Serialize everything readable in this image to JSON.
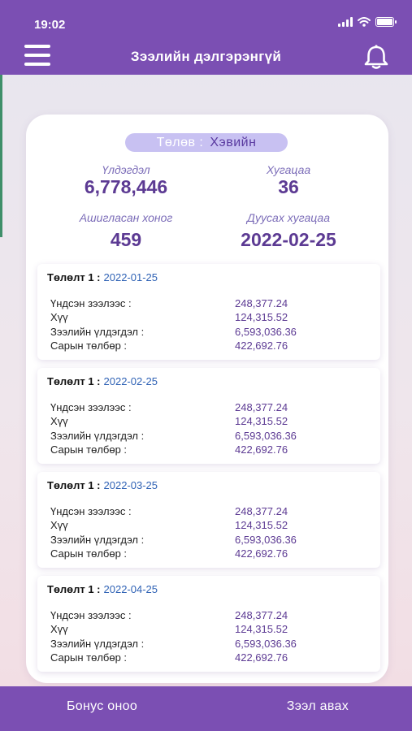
{
  "status_bar": {
    "time": "19:02"
  },
  "header": {
    "title": "Зээлийн дэлгэрэнгүй",
    "menu_icon": "hamburger-icon",
    "bell_icon": "bell-icon"
  },
  "loan": {
    "status_label": "Төлөв :",
    "status_value": "Хэвийн",
    "balance_label": "Үлдэгдэл",
    "balance_value": "6,778,446",
    "term_label": "Хугацаа",
    "term_value": "36",
    "used_days_label": "Ашигласан хоног",
    "used_days_value": "459",
    "end_date_label": "Дуусах хугацаа",
    "end_date_value": "2022-02-25"
  },
  "payments": [
    {
      "title": "Төлөлт 1 :",
      "date": "2022-01-25",
      "rows": [
        {
          "label": "Үндсэн зээлээс :",
          "value": "248,377.24"
        },
        {
          "label": "Хүү",
          "value": "124,315.52"
        },
        {
          "label": "Зээлийн үлдэгдэл :",
          "value": "6,593,036.36"
        },
        {
          "label": "Сарын төлбөр :",
          "value": "422,692.76"
        }
      ]
    },
    {
      "title": "Төлөлт 1 :",
      "date": "2022-02-25",
      "rows": [
        {
          "label": "Үндсэн зээлээс :",
          "value": "248,377.24"
        },
        {
          "label": "Хүү",
          "value": "124,315.52"
        },
        {
          "label": "Зээлийн үлдэгдэл :",
          "value": "6,593,036.36"
        },
        {
          "label": "Сарын төлбөр :",
          "value": "422,692.76"
        }
      ]
    },
    {
      "title": "Төлөлт 1 :",
      "date": "2022-03-25",
      "rows": [
        {
          "label": "Үндсэн зээлээс :",
          "value": "248,377.24"
        },
        {
          "label": "Хүү",
          "value": "124,315.52"
        },
        {
          "label": "Зээлийн үлдэгдэл :",
          "value": "6,593,036.36"
        },
        {
          "label": "Сарын төлбөр :",
          "value": "422,692.76"
        }
      ]
    },
    {
      "title": "Төлөлт 1 :",
      "date": "2022-04-25",
      "rows": [
        {
          "label": "Үндсэн зээлээс :",
          "value": "248,377.24"
        },
        {
          "label": "Хүү",
          "value": "124,315.52"
        },
        {
          "label": "Зээлийн үлдэгдэл :",
          "value": "6,593,036.36"
        },
        {
          "label": "Сарын төлбөр :",
          "value": "422,692.76"
        }
      ]
    }
  ],
  "footer": {
    "bonus_label": "Бонус оноо",
    "loan_label": "Зээл авах"
  },
  "colors": {
    "primary": "#7b4fb3",
    "accent_text": "#5c3a93",
    "date_blue": "#2f62b5",
    "pill": "#c8c1f2"
  }
}
